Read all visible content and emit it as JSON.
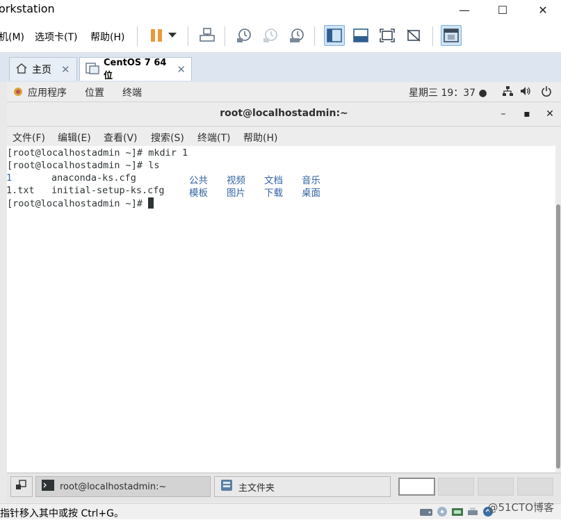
{
  "app": {
    "title": "orkstation",
    "min_glyph": "—",
    "max_glyph": "☐",
    "close_glyph": "✕"
  },
  "vm_menu": {
    "items": [
      "机(M)",
      "选项卡(T)",
      "帮助(H)"
    ]
  },
  "tabs": [
    {
      "label": "主页",
      "icon": "home-icon"
    },
    {
      "label": "CentOS 7 64 位",
      "icon": "vm-icon"
    }
  ],
  "tab_close_glyph": "✕",
  "gnome_panel": {
    "applications": "应用程序",
    "places": "位置",
    "terminal": "终端",
    "clock": "星期三 19：37 ●"
  },
  "terminal": {
    "title": "root@localhostadmin:~",
    "min_glyph": "–",
    "max_glyph": "▪",
    "close_glyph": "✕",
    "menu": [
      "文件(F)",
      "编辑(E)",
      "查看(V)",
      "搜索(S)",
      "终端(T)",
      "帮助(H)"
    ],
    "lines": [
      {
        "prompt": "[root@localhostadmin ~]# ",
        "text": "mkdir 1"
      },
      {
        "prompt": "[root@localhostadmin ~]# ",
        "text": "ls"
      }
    ],
    "ls_row1": {
      "a": "1",
      "b": "anaconda-ks.cfg",
      "c": "公共",
      "d": "视频",
      "e": "文档",
      "f": "音乐"
    },
    "ls_row2": {
      "a": "1.txt",
      "b": "initial-setup-ks.cfg",
      "c": "模板",
      "d": "图片",
      "e": "下载",
      "f": "桌面"
    },
    "last_prompt": "[root@localhostadmin ~]# "
  },
  "taskbar": {
    "items": [
      "root@localhostadmin:~",
      "主文件夹"
    ]
  },
  "status_bar": {
    "text": "指针移入其中或按 Ctrl+G。",
    "watermark": "@51CTO博客"
  },
  "colors": {
    "accent_blue": "#3465a4",
    "tab_bg": "#dde6f0",
    "pause_orange": "#e79a3a"
  }
}
